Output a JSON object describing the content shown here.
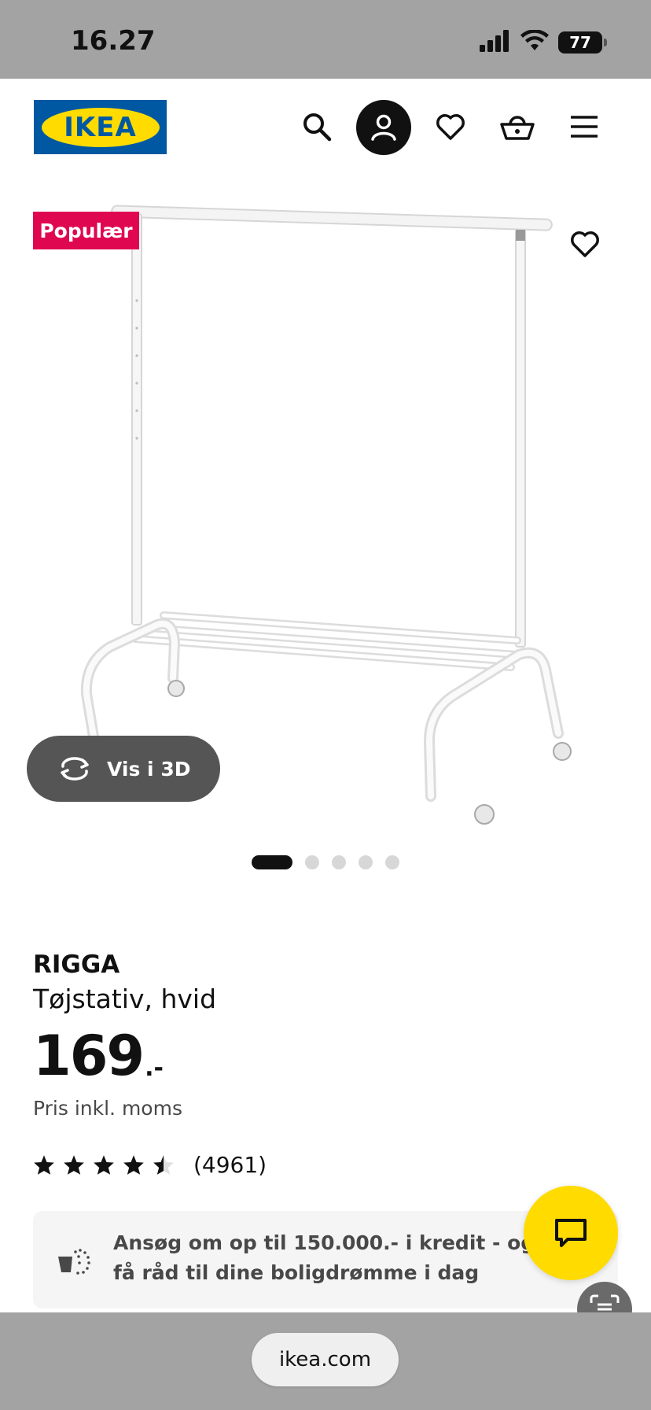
{
  "status_bar": {
    "time": "16.27",
    "battery": "77"
  },
  "header": {
    "logo_text": "IKEA",
    "icons": [
      "search-icon",
      "profile-icon",
      "heart-icon",
      "basket-icon",
      "menu-icon"
    ]
  },
  "product_image": {
    "badge": "Populær",
    "view_3d_label": "Vis i 3D",
    "carousel": {
      "count": 5,
      "active_index": 0
    }
  },
  "product": {
    "name": "RIGGA",
    "description": "Tøjstativ, hvid",
    "price": "169",
    "price_suffix": ".-",
    "price_note": "Pris inkl. moms",
    "rating": 4.5,
    "rating_count": "(4961)"
  },
  "credit_banner": {
    "text": "Ansøg om op til 150.000.- i kredit - og få råd til dine boligdrømme i dag"
  },
  "browser": {
    "url": "ikea.com"
  },
  "colors": {
    "brand_blue": "#0058a3",
    "brand_yellow": "#ffdb00",
    "badge_red": "#e00751",
    "status_gray": "#a3a3a3"
  }
}
